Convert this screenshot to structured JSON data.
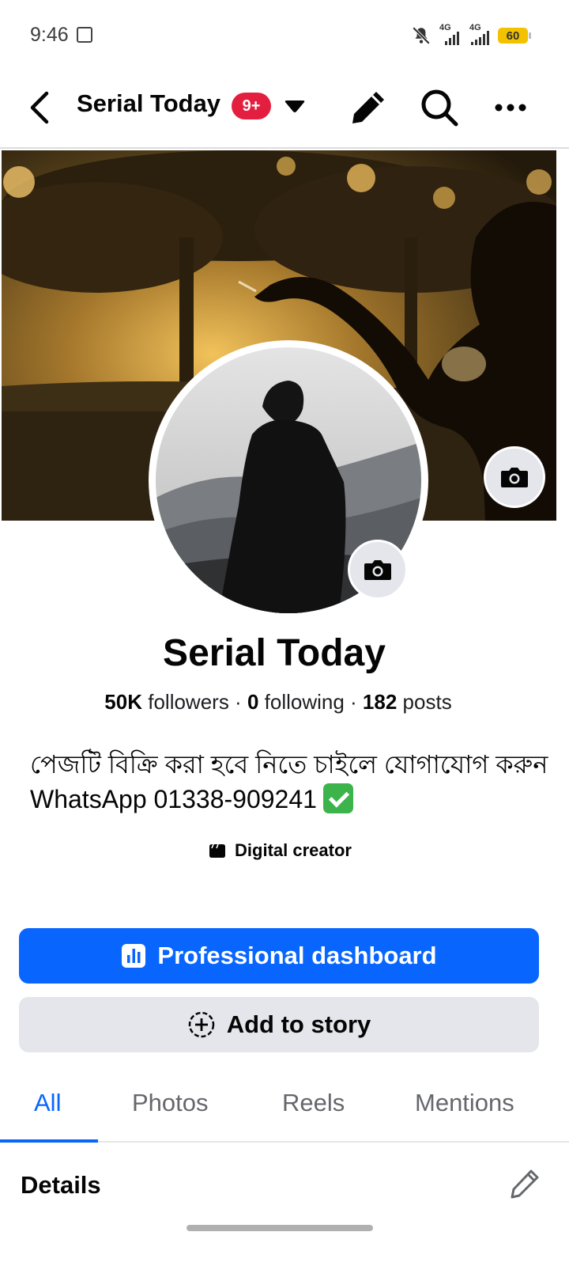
{
  "status_bar": {
    "time": "9:46",
    "network_left": "4G",
    "network_right": "4G",
    "battery": "60"
  },
  "header": {
    "title": "Serial Today",
    "badge": "9+"
  },
  "profile": {
    "name": "Serial Today",
    "followers_count": "50K",
    "followers_label": "followers",
    "following_count": "0",
    "following_label": "following",
    "posts_count": "182",
    "posts_label": "posts",
    "separator": " · ",
    "bio_line1": "পেজটি বিক্রি করা হবে নিতে চাইলে যোগাযোগ করুন",
    "bio_line2": "WhatsApp 01338-909241",
    "category": "Digital creator"
  },
  "actions": {
    "primary_label": "Professional dashboard",
    "secondary_label": "Add to story"
  },
  "tabs": [
    {
      "label": "All",
      "active": true
    },
    {
      "label": "Photos",
      "active": false
    },
    {
      "label": "Reels",
      "active": false
    },
    {
      "label": "Mentions",
      "active": false
    }
  ],
  "details": {
    "title": "Details"
  },
  "colors": {
    "accent": "#0866ff",
    "badge": "#e41e3f",
    "secondary_button": "#e4e6eb"
  }
}
